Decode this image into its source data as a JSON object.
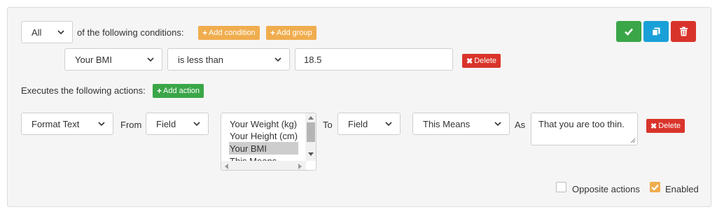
{
  "conditions": {
    "match_select": "All",
    "intro_text": "of the following conditions:",
    "add_condition_label": "Add condition",
    "add_group_label": "Add group",
    "rows": [
      {
        "field": "Your BMI",
        "operator": "is less than",
        "value": "18.5",
        "delete_label": "Delete"
      }
    ]
  },
  "actions": {
    "heading": "Executes the following actions:",
    "add_action_label": "Add action",
    "row": {
      "action": "Format Text",
      "from_label": "From",
      "from_type": "Field",
      "source_options": [
        "Your Weight (kg)",
        "Your Height (cm)",
        "Your BMI",
        "This Means"
      ],
      "selected_source": "Your BMI",
      "to_label": "To",
      "to_type": "Field",
      "target": "This Means",
      "as_label": "As",
      "text": "That you are too thin.",
      "delete_label": "Delete"
    }
  },
  "footer": {
    "opposite_actions_label": "Opposite actions",
    "opposite_actions_checked": false,
    "enabled_label": "Enabled",
    "enabled_checked": true
  },
  "toolbar": {
    "save_icon": "check-icon",
    "duplicate_icon": "copy-icon",
    "delete_icon": "trash-icon"
  },
  "colors": {
    "orange": "#f0ad4e",
    "green": "#3aa648",
    "blue": "#1aa0d8",
    "red": "#d9342b",
    "panel_bg": "#f5f5f5"
  }
}
